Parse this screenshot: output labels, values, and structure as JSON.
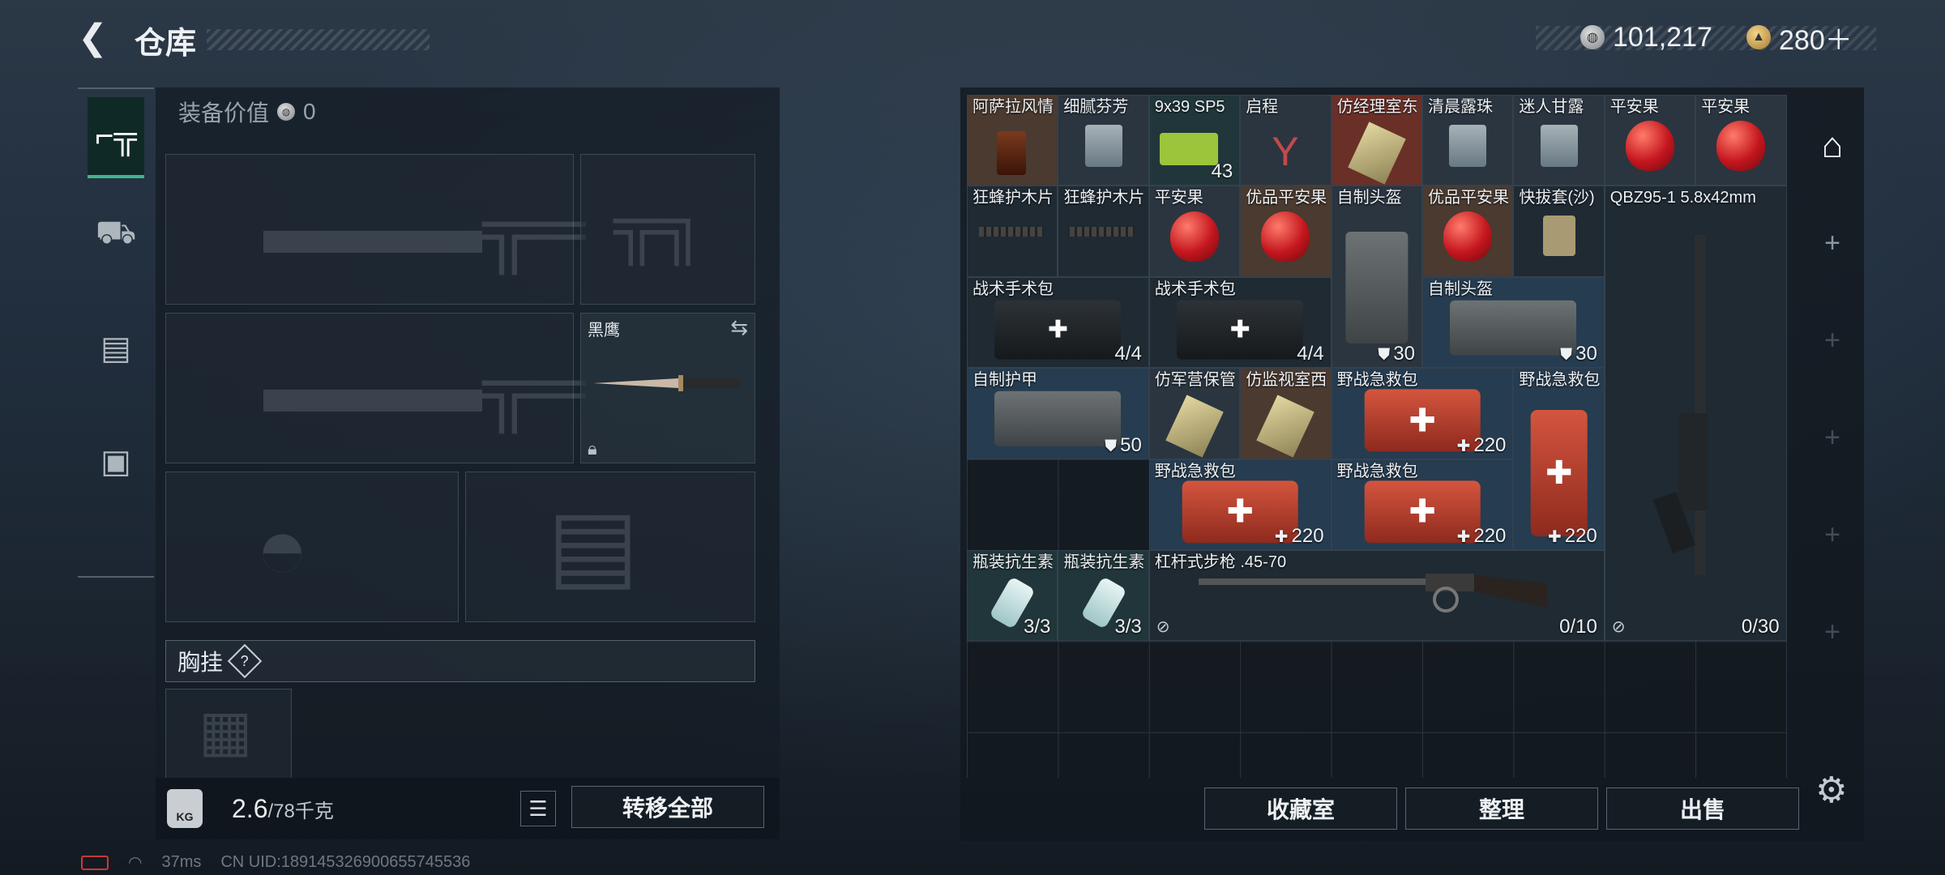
{
  "header": {
    "title": "仓库",
    "currency1": "101,217",
    "currency2": "280＋"
  },
  "left": {
    "equip_value_label": "装备价值",
    "equip_value": "0",
    "knife_name": "黑鹰",
    "chest_label": "胸挂",
    "chest_help": "?",
    "weight": "2.6",
    "weight_max": "/78千克",
    "transfer_all": "转移全部",
    "kg_icon_text": "KG"
  },
  "buttons": {
    "collection": "收藏室",
    "organize": "整理",
    "sell": "出售"
  },
  "items": [
    {
      "name": "阿萨拉风情",
      "qty": "",
      "art": "drink"
    },
    {
      "name": "细腻芬芳",
      "qty": "",
      "art": "cup"
    },
    {
      "name": "9x39 SP5",
      "qty": "43",
      "art": "ammo"
    },
    {
      "name": "启程",
      "qty": "",
      "art": "cocktail"
    },
    {
      "name": "仿经理室东",
      "qty": "",
      "art": "key"
    },
    {
      "name": "清晨露珠",
      "qty": "",
      "art": "cup"
    },
    {
      "name": "迷人甘露",
      "qty": "",
      "art": "cup"
    },
    {
      "name": "平安果",
      "qty": "",
      "art": "apple"
    },
    {
      "name": "平安果",
      "qty": "",
      "art": "apple"
    },
    {
      "name": "狂蜂护木片",
      "qty": "",
      "art": "part"
    },
    {
      "name": "狂蜂护木片",
      "qty": "",
      "art": "part"
    },
    {
      "name": "平安果",
      "qty": "",
      "art": "apple"
    },
    {
      "name": "优品平安果",
      "qty": "",
      "art": "apple"
    },
    {
      "name": "自制头盔",
      "qty": "30",
      "art": "helmet"
    },
    {
      "name": "优品平安果",
      "qty": "",
      "art": "apple"
    },
    {
      "name": "快拔套(沙)",
      "qty": "",
      "art": "holster"
    },
    {
      "name": "QBZ95-1 5.8x42mm",
      "qty": "0/30",
      "art": "rifle"
    },
    {
      "name": "战术手术包",
      "qty": "4/4",
      "art": "pouch"
    },
    {
      "name": "战术手术包",
      "qty": "4/4",
      "art": "pouch"
    },
    {
      "name": "自制头盔",
      "qty": "30",
      "art": "helmet"
    },
    {
      "name": "自制护甲",
      "qty": "50",
      "art": "vest"
    },
    {
      "name": "仿军营保管",
      "qty": "",
      "art": "key"
    },
    {
      "name": "仿监视室西",
      "qty": "",
      "art": "key"
    },
    {
      "name": "野战急救包",
      "qty": "220",
      "art": "medkit"
    },
    {
      "name": "野战急救包",
      "qty": "220",
      "art": "medkit"
    },
    {
      "name": "野战急救包",
      "qty": "220",
      "art": "medkit"
    },
    {
      "name": "野战急救包",
      "qty": "220",
      "art": "medkit"
    },
    {
      "name": "瓶装抗生素",
      "qty": "3/3",
      "art": "pill"
    },
    {
      "name": "瓶装抗生素",
      "qty": "3/3",
      "art": "pill"
    },
    {
      "name": "杠杆式步枪 .45-70",
      "qty": "0/10",
      "art": "lever"
    }
  ],
  "footer": {
    "ping": "37ms",
    "uid": "CN UID:18914532690065574553​6"
  }
}
